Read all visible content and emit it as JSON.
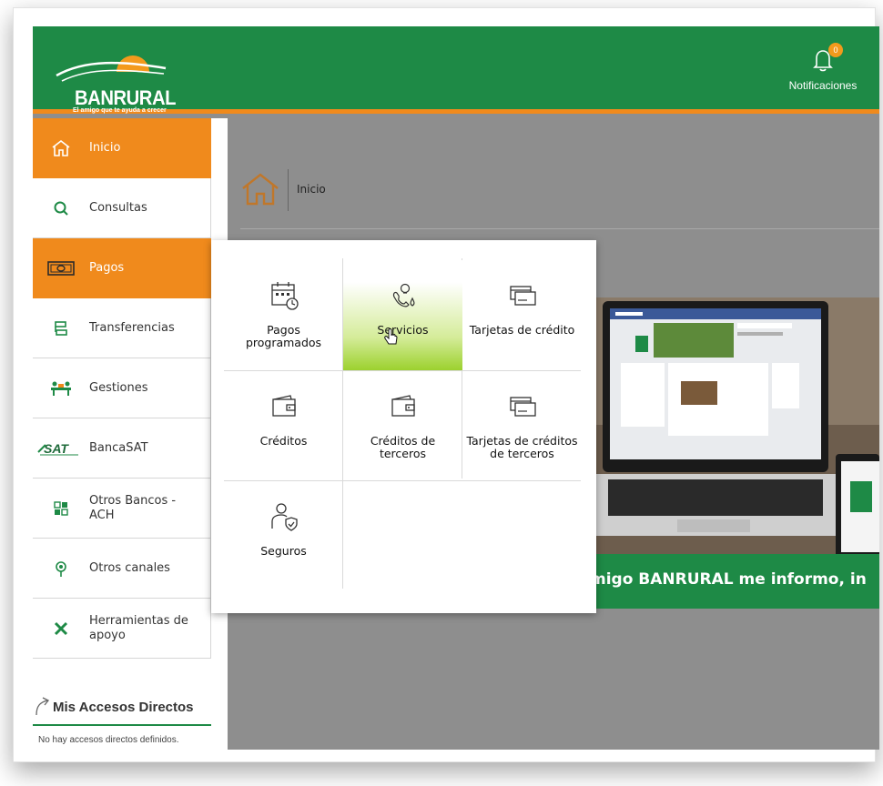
{
  "header": {
    "logo_text": "BANRURAL",
    "logo_tagline": "El amigo que te ayuda a crecer",
    "notifications_label": "Notificaciones",
    "notifications_count": "0"
  },
  "sidebar": {
    "items": [
      {
        "label": "Inicio",
        "icon": "home-icon"
      },
      {
        "label": "Consultas",
        "icon": "search-icon"
      },
      {
        "label": "Pagos",
        "icon": "money-bill-icon"
      },
      {
        "label": "Transferencias",
        "icon": "transfer-icon"
      },
      {
        "label": "Gestiones",
        "icon": "desk-icon"
      },
      {
        "label": "BancaSAT",
        "icon": "sat-logo-icon"
      },
      {
        "label": "Otros Bancos - ACH",
        "icon": "bank-ach-icon"
      },
      {
        "label": "Otros canales",
        "icon": "channels-icon"
      },
      {
        "label": "Herramientas de apoyo",
        "icon": "tools-icon"
      }
    ],
    "accesos_title": "Mis Accesos Directos",
    "accesos_empty": "No hay accesos directos definidos."
  },
  "breadcrumb": {
    "label": "Inicio"
  },
  "banner": {
    "text": "migo BANRURAL me informo, in"
  },
  "pagos_menu": {
    "tiles": [
      {
        "label": "Pagos programados",
        "icon": "calendar-clock-icon"
      },
      {
        "label": "Servicios",
        "icon": "utilities-icon"
      },
      {
        "label": "Tarjetas de crédito",
        "icon": "credit-card-icon"
      },
      {
        "label": "Créditos",
        "icon": "wallet-icon"
      },
      {
        "label": "Créditos de terceros",
        "icon": "wallet-icon"
      },
      {
        "label": "Tarjetas de créditos de terceros",
        "icon": "credit-card-icon"
      },
      {
        "label": "Seguros",
        "icon": "insurance-person-icon"
      }
    ]
  },
  "colors": {
    "brand_green": "#1e8a46",
    "brand_orange": "#f08a1c",
    "hover_green": "#9cd12e"
  }
}
